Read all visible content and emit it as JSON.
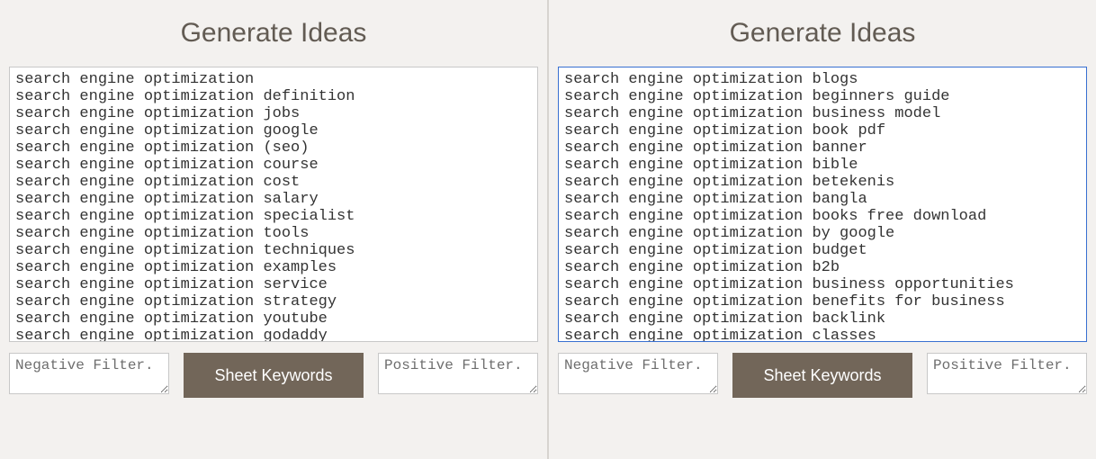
{
  "left": {
    "title": "Generate Ideas",
    "keywords": [
      "search engine optimization",
      "search engine optimization definition",
      "search engine optimization jobs",
      "search engine optimization google",
      "search engine optimization (seo)",
      "search engine optimization course",
      "search engine optimization cost",
      "search engine optimization salary",
      "search engine optimization specialist",
      "search engine optimization tools",
      "search engine optimization techniques",
      "search engine optimization examples",
      "search engine optimization service",
      "search engine optimization strategy",
      "search engine optimization youtube",
      "search engine optimization godaddy"
    ],
    "negative_placeholder": "Negative Filter.",
    "positive_placeholder": "Positive Filter.",
    "negative_value": "",
    "positive_value": "",
    "button_label": "Sheet Keywords"
  },
  "right": {
    "title": "Generate Ideas",
    "keywords": [
      "search engine optimization blogs",
      "search engine optimization beginners guide",
      "search engine optimization business model",
      "search engine optimization book pdf",
      "search engine optimization banner",
      "search engine optimization bible",
      "search engine optimization betekenis",
      "search engine optimization bangla",
      "search engine optimization books free download",
      "search engine optimization by google",
      "search engine optimization budget",
      "search engine optimization b2b",
      "search engine optimization business opportunities",
      "search engine optimization benefits for business",
      "search engine optimization backlink",
      "search engine optimization classes"
    ],
    "negative_placeholder": "Negative Filter.",
    "positive_placeholder": "Positive Filter.",
    "negative_value": "",
    "positive_value": "",
    "button_label": "Sheet Keywords"
  }
}
